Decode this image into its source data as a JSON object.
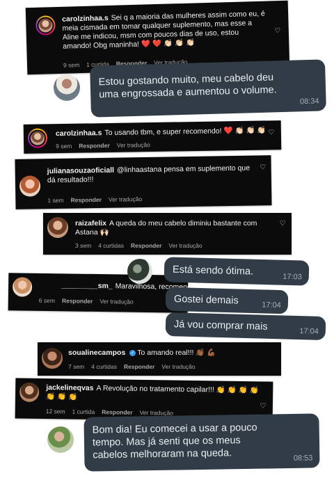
{
  "c1": {
    "username": "carolzinhaa.s",
    "text": "Sei q a maioria das mulheres assim como eu, é meia cismada em tomar qualquer suplemento, mas esse a Aline me indicou, msm com poucos dias de uso, estou amando! Obg maninha! ❤️ ❤️ 👏🏻 👏🏻 👏🏻",
    "time": "9 sem",
    "likes": "1 curtida",
    "reply": "Responder",
    "translate": "Ver tradução"
  },
  "b1": {
    "text": "Estou gostando muito, meu cabelo deu\numa engrossada e aumentou o volume.",
    "time": "08:34"
  },
  "c2": {
    "username": "carolzinhaa.s",
    "text": "To usando tbm, e super recomendo! ❤️ 👏🏻 👏🏻 👏🏻",
    "time": "9 sem",
    "reply": "Responder",
    "translate": "Ver tradução"
  },
  "c3": {
    "username": "julianasouzaoficiall",
    "text": "@linhaastana pensa em suplemento que dá resultado!!!",
    "time": "1 sem",
    "reply": "Responder",
    "translate": "Ver tradução"
  },
  "c4": {
    "username": "raizafelix",
    "text": "A queda do meu cabelo diminiu bastante com Astana 🙌🏻",
    "time": "3 sem",
    "likes": "4 curtidas",
    "reply": "Responder",
    "translate": "Ver tradução"
  },
  "b2": {
    "text": "Está sendo ótima.",
    "time": "17:03"
  },
  "c5": {
    "username": "_________sm_",
    "text": "Maravilhosa, recomendo",
    "time": "6 sem",
    "reply": "Responder",
    "translate": "Ver tradução"
  },
  "b3": {
    "text": "Gostei demais",
    "time": "17:04"
  },
  "b4": {
    "text": "Já vou comprar mais",
    "time": "17:04"
  },
  "c6": {
    "username": "soualinecampos",
    "text": "To amando real!!! 👏🏾 💪🏾",
    "time": "7 sem",
    "likes": "4 curtidas",
    "reply": "Responder",
    "translate": "Ver tradução"
  },
  "c7": {
    "username": "jackelineqvas",
    "text": "A Revolução no tratamento capilar!!! 👏 👏 👏 👏 👏 👏 👏",
    "time": "12 sem",
    "likes": "1 curtida",
    "reply": "Responder",
    "translate": "Ver tradução"
  },
  "b5": {
    "text": "Bom dia! Eu comecei a usar a pouco\ntempo.  Mas já senti que os meus\ncabelos melhoraram na queda.",
    "time": "08:53"
  },
  "colors": {
    "comment_bg": "#0b0b0b",
    "bubble_bg": "#323c47",
    "heart_red": "#e0245e",
    "verified_blue": "#3897f0"
  },
  "icons": {
    "like": "heart-outline-icon",
    "verified": "verified-badge-icon"
  }
}
